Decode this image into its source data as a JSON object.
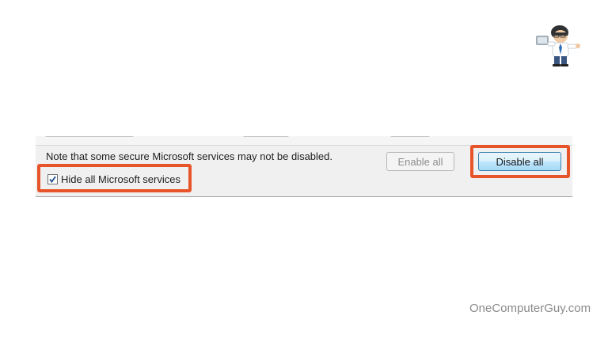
{
  "dialog": {
    "note": "Note that some secure Microsoft services may not be disabled.",
    "enable_all_label": "Enable all",
    "enable_all_enabled": false,
    "disable_all_label": "Disable all",
    "hide_checkbox": {
      "label": "Hide all Microsoft services",
      "checked": true
    }
  },
  "annotations": {
    "highlight_color": "#e8542a"
  },
  "watermark": "OneComputerGuy.com",
  "logo": {
    "icon": "mascot-man-with-laptop-icon"
  }
}
